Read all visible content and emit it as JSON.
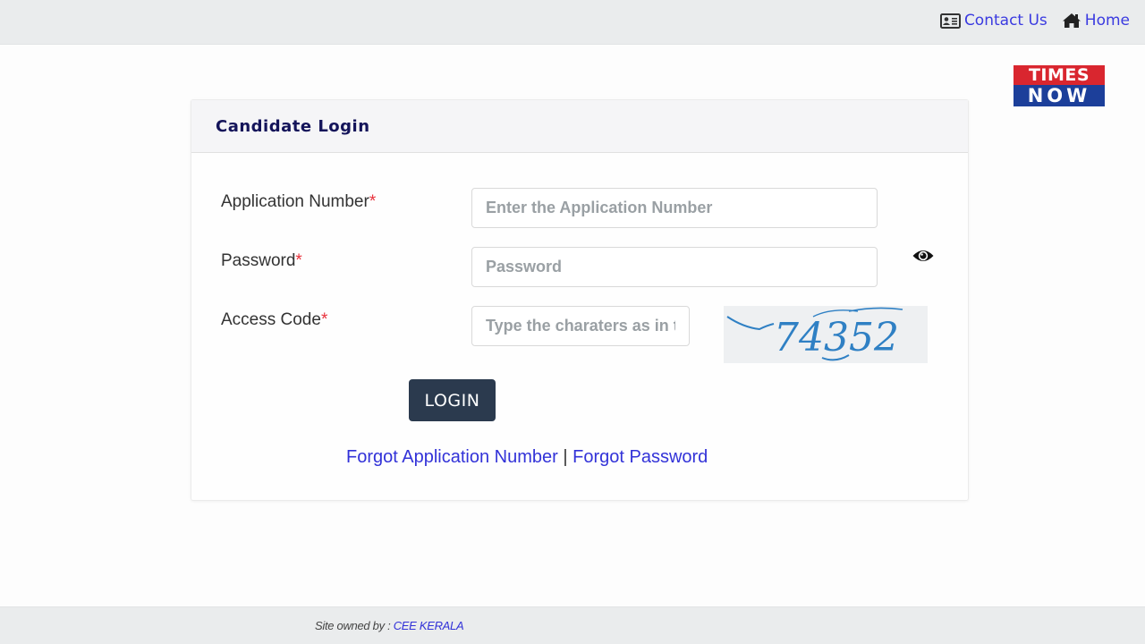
{
  "topnav": {
    "contact_label": "Contact Us",
    "contact_icon": "contact-card-icon",
    "home_label": "Home",
    "home_icon": "home-icon",
    "link_color": "#3a3ae0"
  },
  "logo": {
    "line1": "TIMES",
    "line2": "NOW",
    "colors": {
      "top": "#d9262f",
      "bottom": "#1c3f9a"
    }
  },
  "card": {
    "title": "Candidate Login"
  },
  "form": {
    "required_marker": "*",
    "application_number": {
      "label": "Application Number",
      "placeholder": "Enter the Application Number",
      "value": ""
    },
    "password": {
      "label": "Password",
      "placeholder": "Password",
      "value": "",
      "toggle_icon": "eye-icon"
    },
    "access_code": {
      "label": "Access Code",
      "placeholder": "Type the charaters as in the image",
      "value": "",
      "captcha_text": "74352"
    },
    "login_label": "LOGIN",
    "login_color": "#2b3a4e"
  },
  "links": {
    "forgot_app_number": "Forgot Application Number",
    "separator": "|",
    "forgot_password": "Forgot Password"
  },
  "footer": {
    "prefix": "Site owned by : ",
    "owner": "CEE KERALA"
  }
}
